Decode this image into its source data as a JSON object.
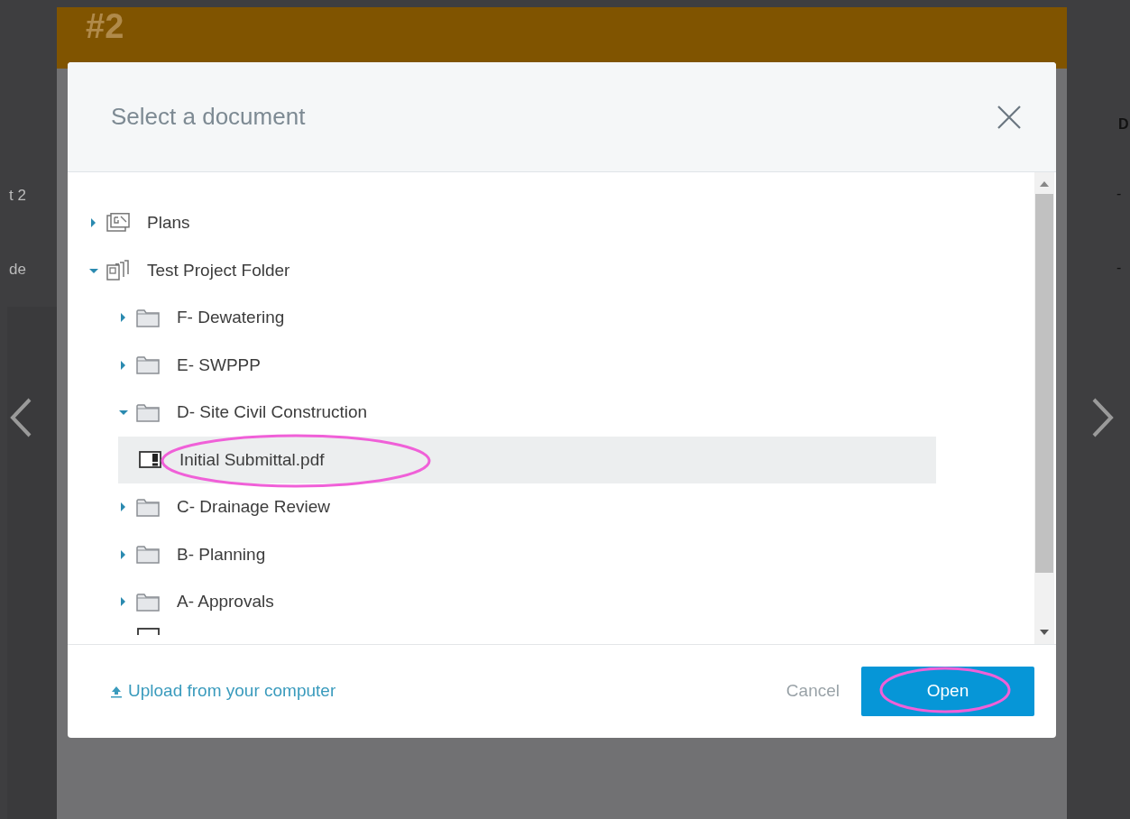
{
  "background": {
    "header_title": "#2",
    "left_cells": [
      "t 2",
      "de"
    ],
    "right_header": "D",
    "right_cells": [
      "-",
      "-"
    ]
  },
  "dialog": {
    "title": "Select a document",
    "tree": [
      {
        "kind": "plans",
        "label": "Plans",
        "expanded": false,
        "selected": false
      },
      {
        "kind": "project",
        "label": "Test Project Folder",
        "expanded": true,
        "selected": false,
        "children": [
          {
            "kind": "folder",
            "label": "F- Dewatering",
            "expanded": false,
            "selected": false
          },
          {
            "kind": "folder",
            "label": "E- SWPPP",
            "expanded": false,
            "selected": false
          },
          {
            "kind": "folder",
            "label": "D- Site Civil Construction",
            "expanded": true,
            "selected": false,
            "children": [
              {
                "kind": "file",
                "label": "Initial Submittal.pdf",
                "selected": true
              }
            ]
          },
          {
            "kind": "folder",
            "label": "C- Drainage Review",
            "expanded": false,
            "selected": false
          },
          {
            "kind": "folder",
            "label": "B- Planning",
            "expanded": false,
            "selected": false
          },
          {
            "kind": "folder",
            "label": "A- Approvals",
            "expanded": false,
            "selected": false
          }
        ]
      }
    ],
    "upload_link": "Upload from your computer",
    "cancel_button": "Cancel",
    "open_button": "Open"
  }
}
